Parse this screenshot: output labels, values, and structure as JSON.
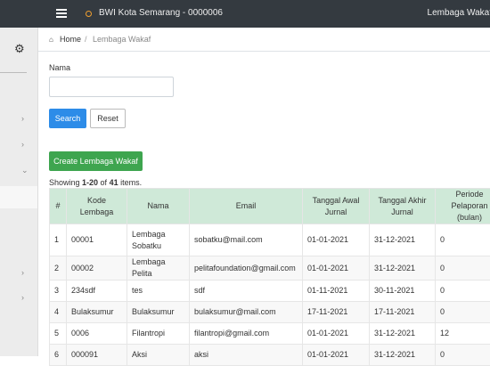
{
  "topbar": {
    "menu_icon": "hamburger-icon",
    "app_title": "BWI Kota Semarang - 0000006",
    "user_name": "Lembaga Wakaf"
  },
  "sidebar": {
    "settings_icon": "gear-icon"
  },
  "breadcrumb": {
    "home": "Home",
    "separator": "/",
    "current": "Lembaga Wakaf"
  },
  "filter": {
    "nama_label": "Nama",
    "nama_value": "",
    "search_label": "Search",
    "reset_label": "Reset"
  },
  "create_label": "Create Lembaga Wakaf",
  "summary": {
    "prefix": "Showing ",
    "range": "1-20",
    "middle": " of ",
    "total": "41",
    "suffix": " items."
  },
  "table": {
    "headers": [
      "#",
      "Kode Lembaga",
      "Nama",
      "Email",
      "Tanggal Awal Jurnal",
      "Tanggal Akhir Jurnal",
      "Periode Pelaporan (bulan)"
    ],
    "rows": [
      [
        "1",
        "00001",
        "Lembaga Sobatku",
        "sobatku@mail.com",
        "01-01-2021",
        "31-12-2021",
        "0"
      ],
      [
        "2",
        "00002",
        "Lembaga Pelita",
        "pelitafoundation@gmail.com",
        "01-01-2021",
        "31-12-2021",
        "0"
      ],
      [
        "3",
        "234sdf",
        "tes",
        "sdf",
        "01-11-2021",
        "30-11-2021",
        "0"
      ],
      [
        "4",
        "Bulaksumur",
        "Bulaksumur",
        "bulaksumur@mail.com",
        "17-11-2021",
        "17-11-2021",
        "0"
      ],
      [
        "5",
        "0006",
        "Filantropi",
        "filantropi@gmail.com",
        "01-01-2021",
        "31-12-2021",
        "12"
      ],
      [
        "6",
        "000091",
        "Aksi",
        "aksi",
        "01-01-2021",
        "31-12-2021",
        "0"
      ]
    ]
  },
  "colors": {
    "topbar": "#343a40",
    "primary": "#2d8ce8",
    "success": "#3ea54f",
    "table_header": "#cfe9d8"
  }
}
